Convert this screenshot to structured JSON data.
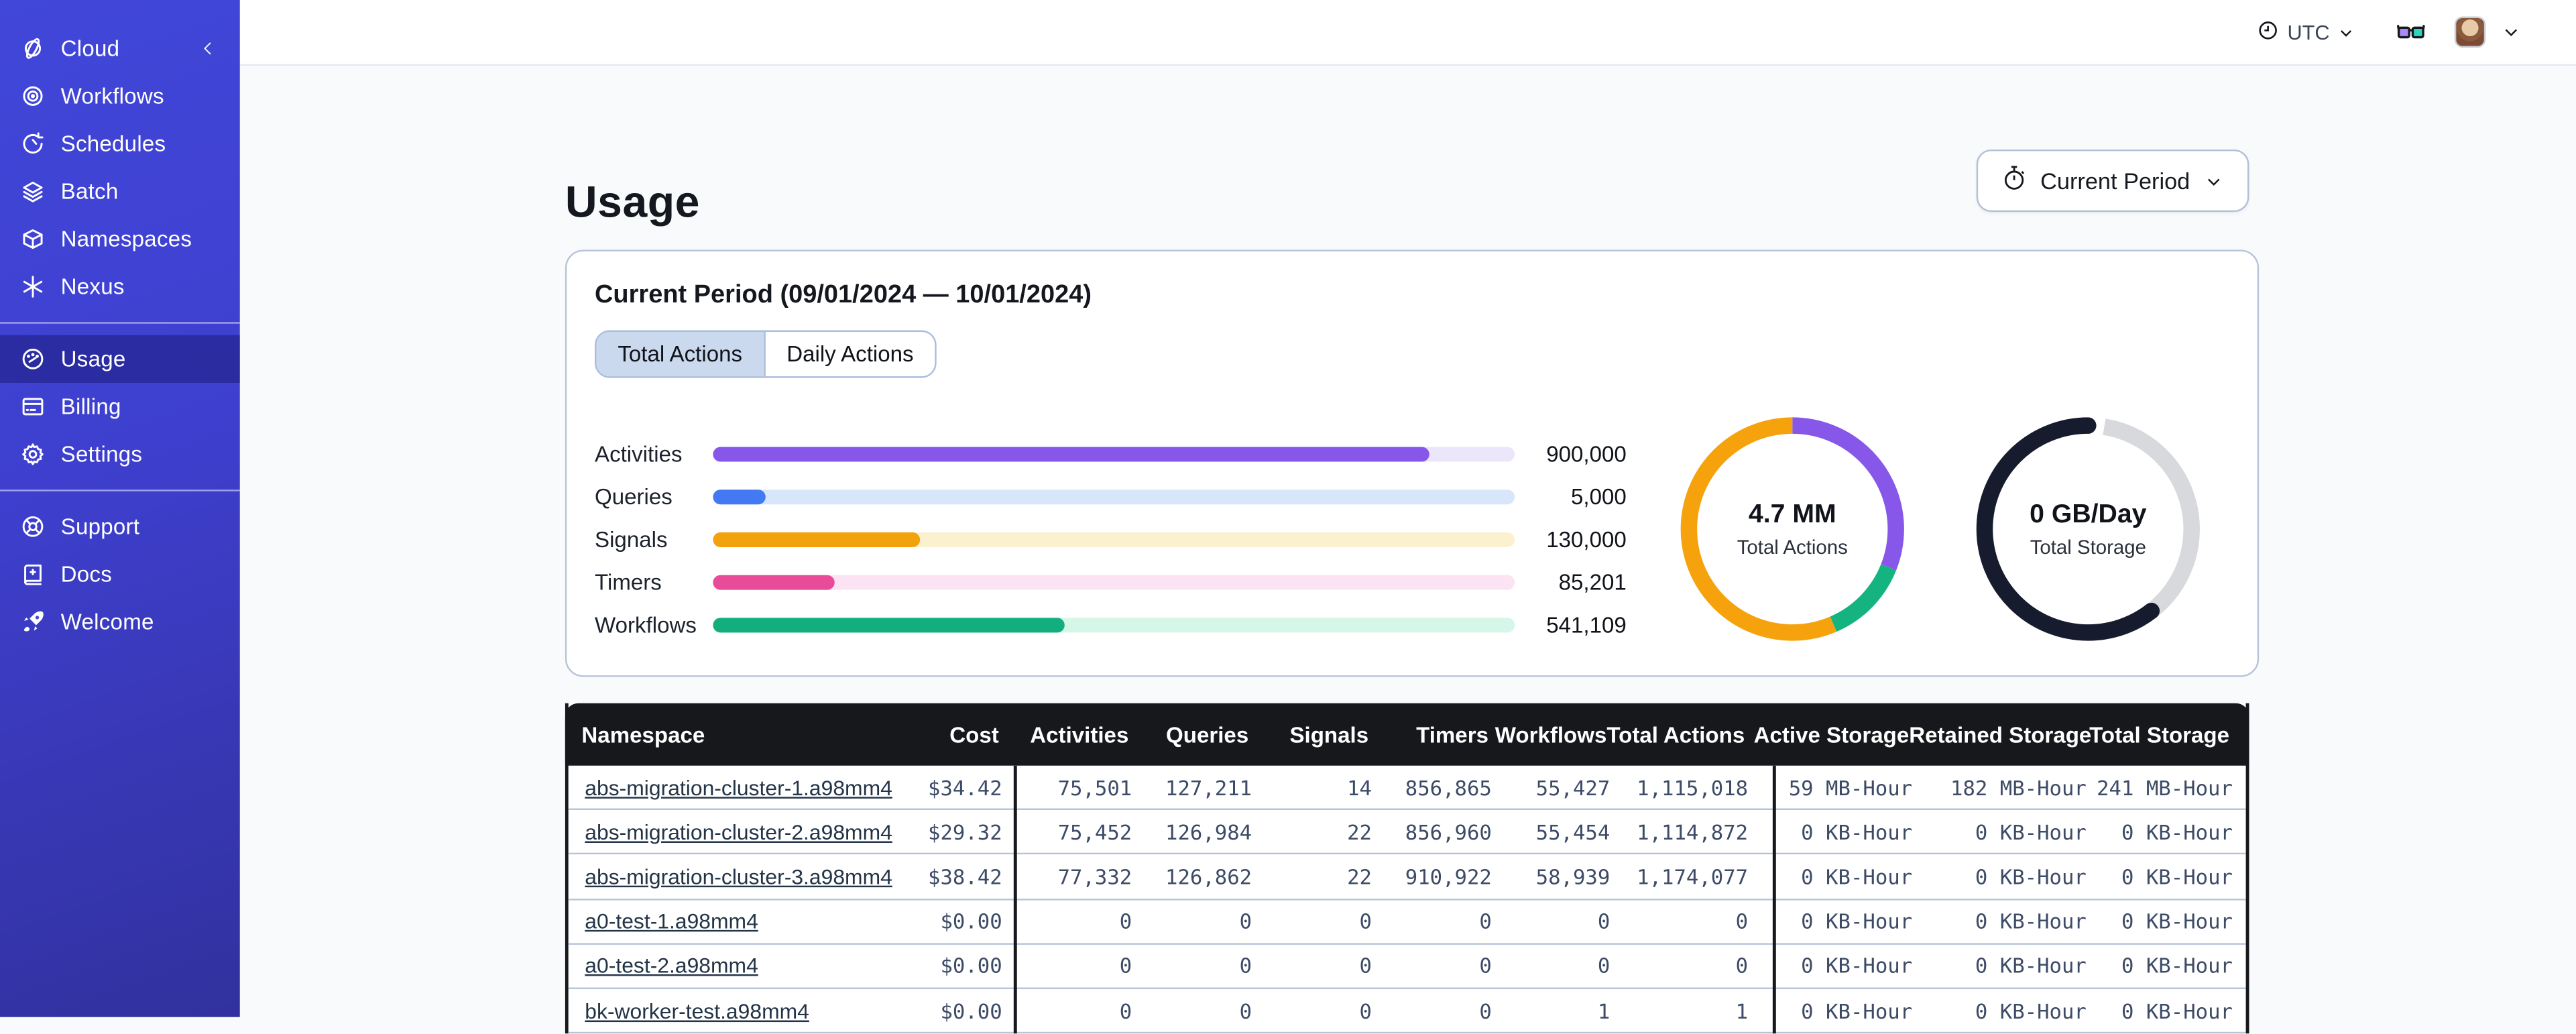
{
  "colors": {
    "sidebar_top": "#4147d9",
    "sidebar_bottom": "#32319e",
    "sidebar_active": "#2e2c96",
    "table_header_bg": "#17181c",
    "card_border": "#b7c4da",
    "tab_active_bg": "#cbd9ef",
    "page_bg": "#f8fafc"
  },
  "sidebar": {
    "sections": [
      {
        "items": [
          {
            "label": "Cloud",
            "icon": "planet-icon",
            "trailing_icon": "collapse-chevron-icon"
          },
          {
            "label": "Workflows",
            "icon": "workflows-spiral-icon"
          },
          {
            "label": "Schedules",
            "icon": "schedule-clock-icon"
          },
          {
            "label": "Batch",
            "icon": "batch-layers-icon"
          },
          {
            "label": "Namespaces",
            "icon": "namespace-cube-icon"
          },
          {
            "label": "Nexus",
            "icon": "nexus-asterisk-icon"
          }
        ]
      },
      {
        "items": [
          {
            "label": "Usage",
            "icon": "usage-gauge-icon",
            "active": true
          },
          {
            "label": "Billing",
            "icon": "billing-card-icon"
          },
          {
            "label": "Settings",
            "icon": "settings-gear-icon"
          }
        ]
      },
      {
        "items": [
          {
            "label": "Support",
            "icon": "support-lifebuoy-icon"
          },
          {
            "label": "Docs",
            "icon": "docs-book-icon"
          },
          {
            "label": "Welcome",
            "icon": "welcome-rocket-icon"
          }
        ]
      }
    ]
  },
  "topbar": {
    "timezone_label": "UTC",
    "icons": [
      "clock-icon",
      "chevron-down-icon",
      "glasses-icon",
      "avatar",
      "chevron-down-icon"
    ]
  },
  "page": {
    "title": "Usage",
    "period_button_label": "Current Period",
    "period_button_icon": "stopwatch-icon"
  },
  "card": {
    "title": "Current Period (09/01/2024 — 10/01/2024)",
    "tabs": [
      {
        "label": "Total Actions",
        "active": true
      },
      {
        "label": "Daily Actions",
        "active": false
      }
    ]
  },
  "chart_data": [
    {
      "type": "bar",
      "title": "Total Actions by type",
      "categories": [
        "Activities",
        "Queries",
        "Signals",
        "Timers",
        "Workflows"
      ],
      "values": [
        900000,
        5000,
        130000,
        85201,
        541109
      ],
      "display_values": [
        "900,000",
        "5,000",
        "130,000",
        "85,201",
        "541,109"
      ],
      "fill_fractions": [
        0.893,
        0.066,
        0.259,
        0.152,
        0.439
      ],
      "bar_colors": [
        "#8757e9",
        "#4379f2",
        "#f2a20d",
        "#e84b97",
        "#13ae7e"
      ],
      "track_colors": [
        "#ece6fa",
        "#d8e6fa",
        "#fcf1ce",
        "#fbe3f3",
        "#d5f6e8"
      ],
      "xlabel": "",
      "ylabel": "",
      "grid": false,
      "legend": "none"
    },
    {
      "type": "pie",
      "variant": "donut",
      "center_value": "4.7 MM",
      "center_label": "Total Actions",
      "segments": [
        {
          "name": "purple",
          "color": "#8757e9",
          "fraction": 0.31
        },
        {
          "name": "green",
          "color": "#14b380",
          "fraction": 0.125
        },
        {
          "name": "orange",
          "color": "#f6a20d",
          "fraction": 0.565
        }
      ]
    },
    {
      "type": "pie",
      "variant": "donut",
      "center_value": "0 GB/Day",
      "center_label": "Total Storage",
      "segments": [
        {
          "name": "gray",
          "color": "#d7d9dd",
          "fraction": 0.37,
          "start": 0.025
        },
        {
          "name": "navy",
          "color": "#161c2d",
          "fraction": 0.63,
          "start": 0.395,
          "round_caps": true
        }
      ]
    }
  ],
  "table": {
    "columns": [
      "Namespace",
      "Cost",
      "Activities",
      "Queries",
      "Signals",
      "Timers",
      "Workflows",
      "Total Actions",
      "Active Storage",
      "Retained Storage",
      "Total Storage"
    ],
    "rows": [
      {
        "namespace": "abs-migration-cluster-1.a98mm4",
        "cost": "$34.42",
        "activities": "75,501",
        "queries": "127,211",
        "signals": "14",
        "timers": "856,865",
        "workflows": "55,427",
        "total_actions": "1,115,018",
        "active_storage": "59 MB-Hour",
        "retained_storage": "182 MB-Hour",
        "total_storage": "241 MB-Hour"
      },
      {
        "namespace": "abs-migration-cluster-2.a98mm4",
        "cost": "$29.32",
        "activities": "75,452",
        "queries": "126,984",
        "signals": "22",
        "timers": "856,960",
        "workflows": "55,454",
        "total_actions": "1,114,872",
        "active_storage": "0 KB-Hour",
        "retained_storage": "0 KB-Hour",
        "total_storage": "0 KB-Hour"
      },
      {
        "namespace": "abs-migration-cluster-3.a98mm4",
        "cost": "$38.42",
        "activities": "77,332",
        "queries": "126,862",
        "signals": "22",
        "timers": "910,922",
        "workflows": "58,939",
        "total_actions": "1,174,077",
        "active_storage": "0 KB-Hour",
        "retained_storage": "0 KB-Hour",
        "total_storage": "0 KB-Hour"
      },
      {
        "namespace": "a0-test-1.a98mm4",
        "cost": "$0.00",
        "activities": "0",
        "queries": "0",
        "signals": "0",
        "timers": "0",
        "workflows": "0",
        "total_actions": "0",
        "active_storage": "0 KB-Hour",
        "retained_storage": "0 KB-Hour",
        "total_storage": "0 KB-Hour"
      },
      {
        "namespace": "a0-test-2.a98mm4",
        "cost": "$0.00",
        "activities": "0",
        "queries": "0",
        "signals": "0",
        "timers": "0",
        "workflows": "0",
        "total_actions": "0",
        "active_storage": "0 KB-Hour",
        "retained_storage": "0 KB-Hour",
        "total_storage": "0 KB-Hour"
      },
      {
        "namespace": "bk-worker-test.a98mm4",
        "cost": "$0.00",
        "activities": "0",
        "queries": "0",
        "signals": "0",
        "timers": "0",
        "workflows": "1",
        "total_actions": "1",
        "active_storage": "0 KB-Hour",
        "retained_storage": "0 KB-Hour",
        "total_storage": "0 KB-Hour"
      }
    ]
  }
}
